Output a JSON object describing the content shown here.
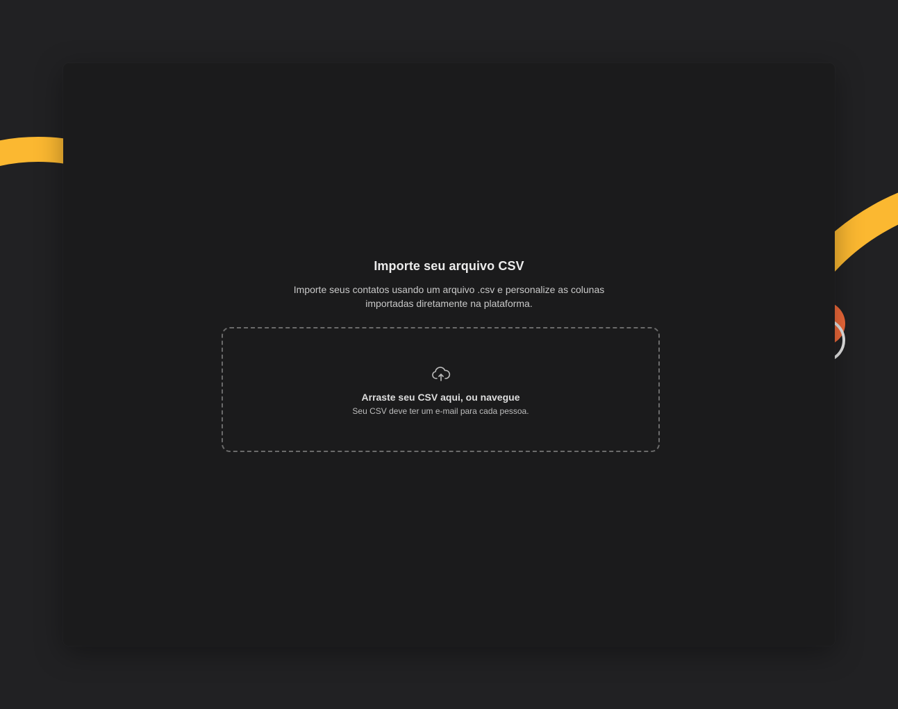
{
  "colors": {
    "page_background": "#212123",
    "modal_background": "#1b1b1c",
    "accent_yellow": "#fbb831",
    "accent_orange": "#f06a3a",
    "dropzone_border": "#6b6b6b"
  },
  "import": {
    "title": "Importe seu arquivo CSV",
    "description": "Importe seus contatos usando um arquivo .csv e personalize as colunas importadas diretamente na plataforma."
  },
  "dropzone": {
    "icon": "cloud-upload-icon",
    "title": "Arraste seu CSV aqui, ou navegue",
    "hint": "Seu CSV deve ter um e-mail para cada pessoa."
  }
}
